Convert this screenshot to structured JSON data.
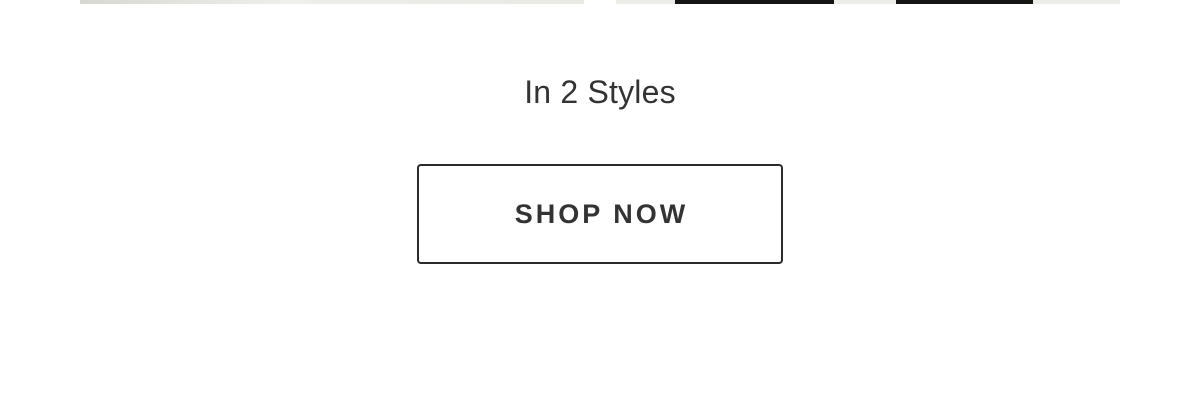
{
  "hero": {
    "subtitle": "In 2 Styles",
    "cta_label": "SHOP NOW"
  },
  "colors": {
    "text": "#333333",
    "button_border": "#2b2b2b",
    "background": "#ffffff"
  }
}
